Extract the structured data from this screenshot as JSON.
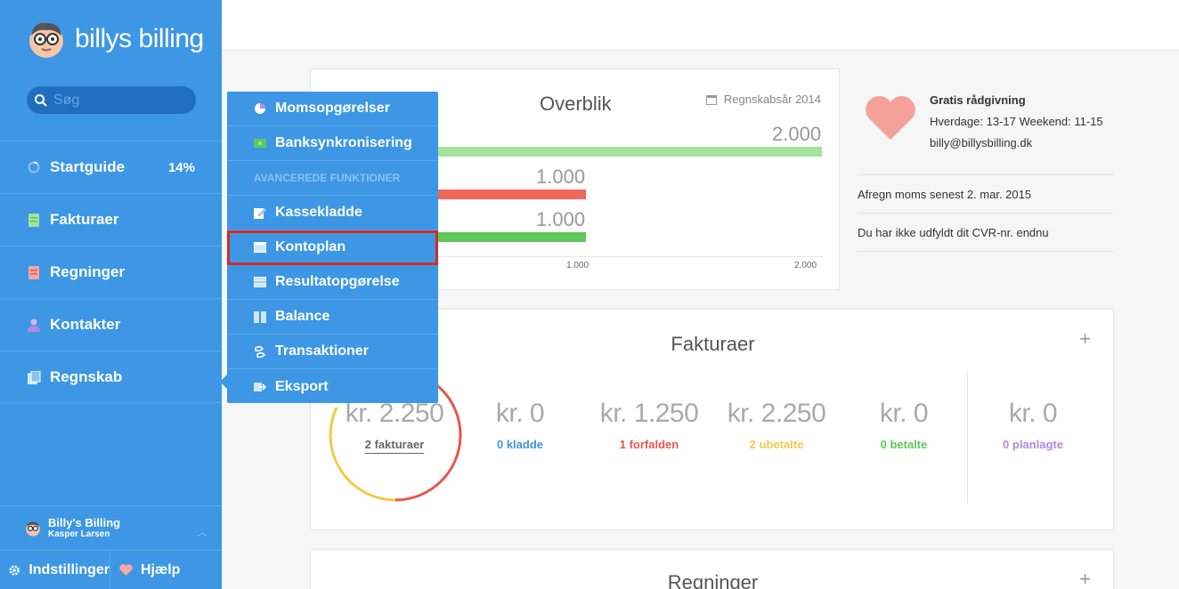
{
  "app": {
    "logo_text": "billys billing"
  },
  "search": {
    "placeholder": "Søg"
  },
  "sidebar": {
    "items": [
      {
        "label": "Startguide",
        "badge": "14%",
        "icon": "spinner-icon"
      },
      {
        "label": "Fakturaer",
        "icon": "invoice-icon"
      },
      {
        "label": "Regninger",
        "icon": "bill-icon"
      },
      {
        "label": "Kontakter",
        "icon": "person-icon"
      },
      {
        "label": "Regnskab",
        "icon": "accounting-icon"
      }
    ],
    "user": {
      "name": "Billy's Billing",
      "sub": "Kasper Larsen"
    },
    "footer": {
      "settings": "Indstillinger",
      "help": "Hjælp"
    }
  },
  "dropdown": {
    "items": [
      {
        "label": "Momsopgørelser",
        "icon": "pie-icon"
      },
      {
        "label": "Banksynkronisering",
        "icon": "bank-icon"
      }
    ],
    "section_header": "AVANCEREDE FUNKTIONER",
    "advanced": [
      {
        "label": "Kassekladde",
        "icon": "edit-icon"
      },
      {
        "label": "Kontoplan",
        "icon": "account-plan-icon",
        "selected": true
      },
      {
        "label": "Resultatopgørelse",
        "icon": "result-icon"
      },
      {
        "label": "Balance",
        "icon": "balance-icon"
      },
      {
        "label": "Transaktioner",
        "icon": "transactions-icon"
      },
      {
        "label": "Eksport",
        "icon": "export-icon"
      }
    ]
  },
  "overblik": {
    "title": "Overblik",
    "year_label": "Regnskabsår 2014",
    "bars": [
      {
        "value_label": "2.000",
        "value": 2000,
        "color": "#a3e39c"
      },
      {
        "value_label": "1.000",
        "value": 1000,
        "color": "#f0675c"
      },
      {
        "value_label": "1.000",
        "value": 1000,
        "color": "#5fc95a"
      }
    ],
    "ticks": [
      "1.000",
      "2.000"
    ],
    "max": 2000
  },
  "info": {
    "title": "Gratis rådgivning",
    "line1": "Hverdage: 13-17 Weekend: 11-15",
    "email": "billy@billysbilling.dk",
    "notice1": "Afregn moms senest 2. mar. 2015",
    "notice2": "Du har ikke udfyldt dit CVR-nr. endnu"
  },
  "fakturaer": {
    "title": "Fakturaer",
    "plus": "+",
    "stats": [
      {
        "amount": "kr. 2.250",
        "label": "2 fakturaer",
        "color": "#666666"
      },
      {
        "amount": "kr. 0",
        "label": "0 kladde",
        "color": "#3d97e4"
      },
      {
        "amount": "kr. 1.250",
        "label": "1 forfalden",
        "color": "#e8574c"
      },
      {
        "amount": "kr. 2.250",
        "label": "2 ubetalte",
        "color": "#f3c94a"
      },
      {
        "amount": "kr. 0",
        "label": "0 betalte",
        "color": "#5fc95a"
      },
      {
        "amount": "kr. 0",
        "label": "0 planlagte",
        "color": "#b18be0"
      }
    ]
  },
  "regninger": {
    "title": "Regninger",
    "plus": "+"
  }
}
